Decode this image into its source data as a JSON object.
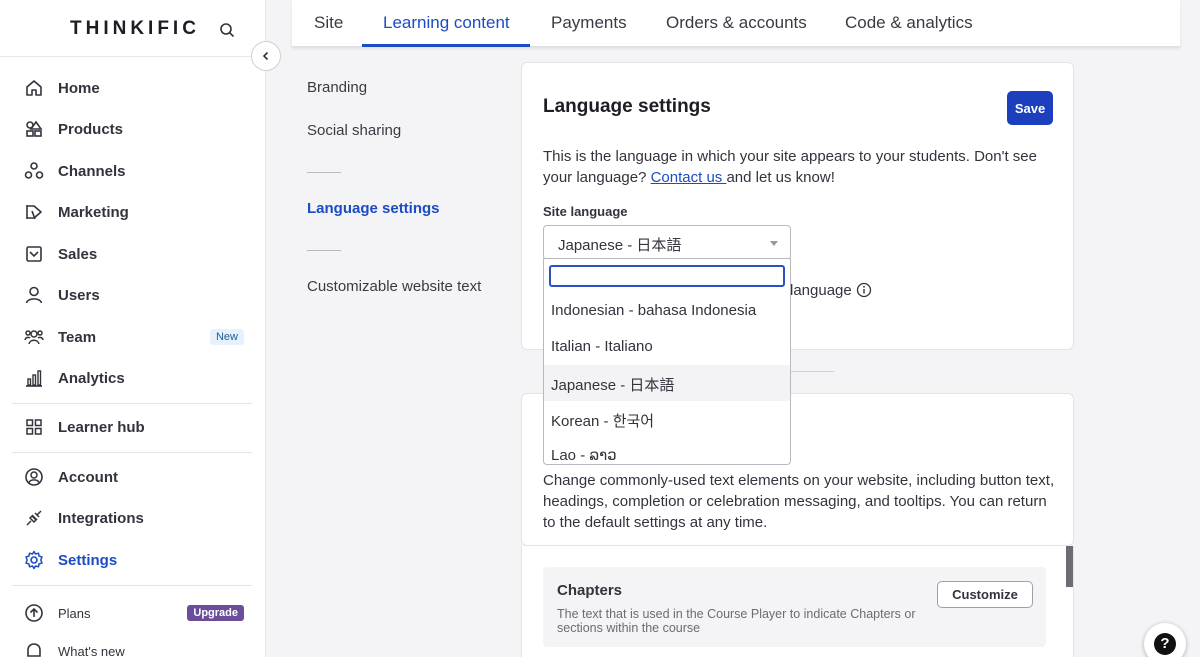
{
  "app": {
    "logo": "THINKIFIC"
  },
  "sidebar": {
    "items": [
      {
        "label": "Home"
      },
      {
        "label": "Products"
      },
      {
        "label": "Channels"
      },
      {
        "label": "Marketing"
      },
      {
        "label": "Sales"
      },
      {
        "label": "Users"
      },
      {
        "label": "Team",
        "badge": "New"
      },
      {
        "label": "Analytics"
      },
      {
        "label": "Learner hub"
      },
      {
        "label": "Account"
      },
      {
        "label": "Integrations"
      },
      {
        "label": "Settings",
        "active": true
      },
      {
        "label": "Plans",
        "badge": "Upgrade"
      },
      {
        "label": "What's new"
      }
    ]
  },
  "tabs": [
    {
      "label": "Site"
    },
    {
      "label": "Learning content",
      "active": true
    },
    {
      "label": "Payments"
    },
    {
      "label": "Orders & accounts"
    },
    {
      "label": "Code & analytics"
    }
  ],
  "subnav": {
    "branding": "Branding",
    "social": "Social sharing",
    "language": "Language settings",
    "custom_text": "Customizable website text"
  },
  "language_card": {
    "title": "Language settings",
    "save_label": "Save",
    "desc_before": "This is the language in which your site appears to your students. Don't see your language? ",
    "contact_link": "Contact us ",
    "desc_after": "and let us know!",
    "field_label": "Site language",
    "selected": "Japanese - 日本語",
    "partial_text": "language"
  },
  "dropdown": {
    "search_value": "",
    "options": [
      "Indonesian - bahasa Indonesia",
      "Italian - Italiano",
      "Japanese - 日本語",
      "Korean - 한국어",
      "Lao - ລາວ"
    ],
    "highlighted_index": 2
  },
  "text_card": {
    "desc": "Change commonly-used text elements on your website, including button text, headings, completion or celebration messaging, and tooltips. You can return to the default settings at any time."
  },
  "chapters": {
    "title": "Chapters",
    "desc": "The text that is used in the Course Player to indicate Chapters or sections within the course",
    "button": "Customize"
  },
  "colors": {
    "accent": "#1c4bc4",
    "save_bg": "#1c3fbd",
    "upgrade_bg": "#6a4e9a"
  }
}
